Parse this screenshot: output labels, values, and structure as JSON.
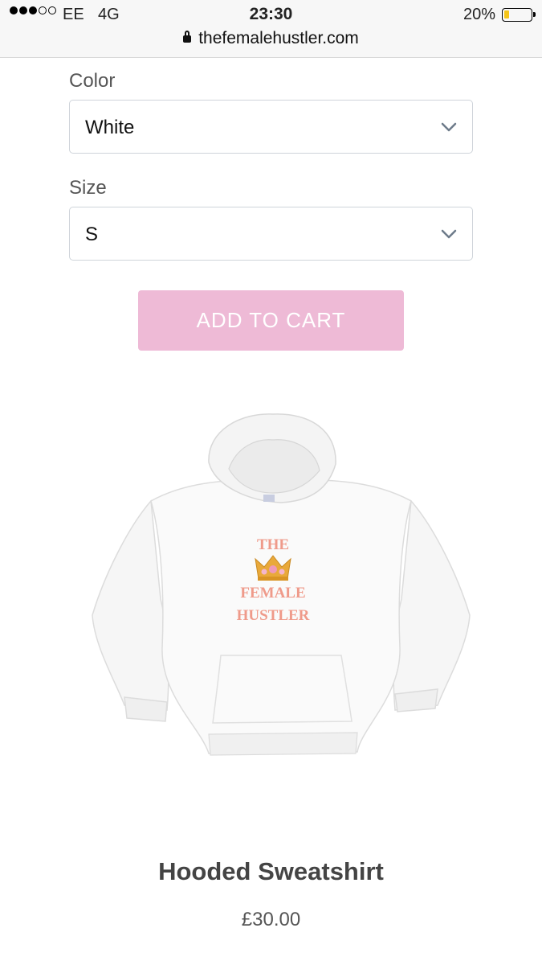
{
  "status_bar": {
    "carrier": "EE",
    "network": "4G",
    "time": "23:30",
    "battery": "20%",
    "battery_level": 0.2,
    "signal_bars": 3
  },
  "browser": {
    "url": "thefemalehustler.com"
  },
  "product_form": {
    "color_label": "Color",
    "color_value": "White",
    "size_label": "Size",
    "size_value": "S",
    "add_to_cart": "ADD TO CART"
  },
  "product": {
    "print_line1": "THE",
    "print_line2": "FEMALE",
    "print_line3": "HUSTLER",
    "title": "Hooded Sweatshirt",
    "price": "£30.00"
  },
  "colors": {
    "accent": "#eebad6",
    "print": "#ef9a8a"
  }
}
